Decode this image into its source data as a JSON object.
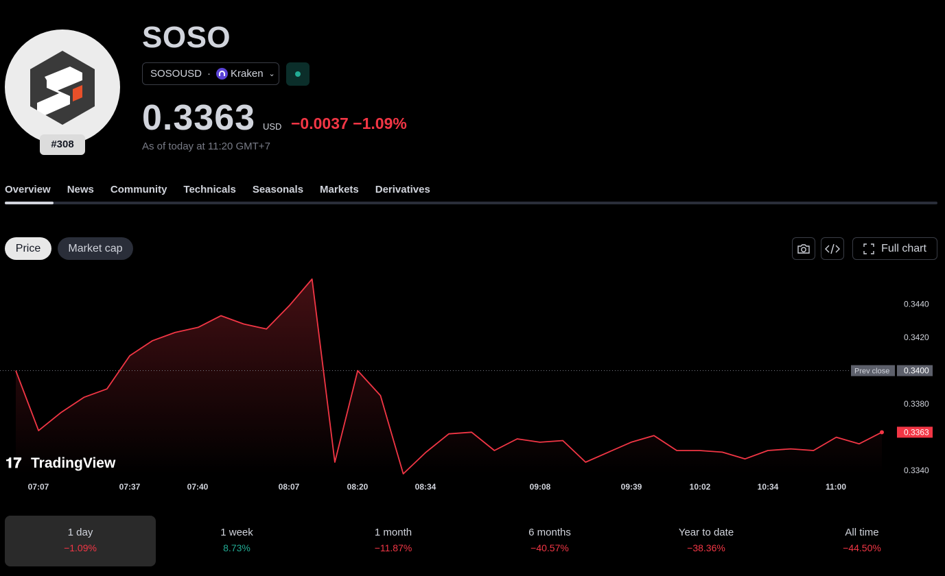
{
  "coin": {
    "name": "SOSO",
    "rank": "#308",
    "pair": "SOSOUSD",
    "separator": "·",
    "exchange": "Kraken",
    "price": "0.3363",
    "currency": "USD",
    "change": "−0.0037 −1.09%",
    "as_of": "As of today at 11:20 GMT+7"
  },
  "tabs": [
    "Overview",
    "News",
    "Community",
    "Technicals",
    "Seasonals",
    "Markets",
    "Derivatives"
  ],
  "chart_toggle": {
    "price": "Price",
    "market_cap": "Market cap"
  },
  "toolbar": {
    "full_chart": "Full chart"
  },
  "watermark": "TradingView",
  "chart_data": {
    "type": "area",
    "x_tick_labels": [
      "07:07",
      "07:37",
      "07:40",
      "08:07",
      "08:20",
      "08:34",
      "09:08",
      "09:39",
      "10:02",
      "10:34",
      "11:00"
    ],
    "y_tick_labels": [
      "0.3440",
      "0.3420",
      "0.3380",
      "0.3340"
    ],
    "ylim": [
      0.3333,
      0.3463
    ],
    "prev_close": {
      "label": "Prev close",
      "value": 0.34,
      "value_label": "0.3400"
    },
    "last": {
      "value": 0.3363,
      "label": "0.3363"
    },
    "series": [
      {
        "values": [
          0.34,
          0.3364,
          0.3375,
          0.3384,
          0.3389,
          0.3409,
          0.3418,
          0.3423,
          0.3426,
          0.3433,
          0.3428,
          0.3425,
          0.3439,
          0.3455,
          0.3345,
          0.34,
          0.3385,
          0.3338,
          0.3351,
          0.3362,
          0.3363,
          0.3352,
          0.3359,
          0.3357,
          0.3358,
          0.3345,
          0.3351,
          0.3357,
          0.3361,
          0.3352,
          0.3352,
          0.3351,
          0.3347,
          0.3352,
          0.3353,
          0.3352,
          0.336,
          0.3356,
          0.3363
        ]
      }
    ],
    "colors": {
      "line": "#f23645",
      "fill": "#f23645"
    },
    "grid": false
  },
  "periods": [
    {
      "label": "1 day",
      "value": "−1.09%",
      "sign": "neg"
    },
    {
      "label": "1 week",
      "value": "8.73%",
      "sign": "pos"
    },
    {
      "label": "1 month",
      "value": "−11.87%",
      "sign": "neg"
    },
    {
      "label": "6 months",
      "value": "−40.57%",
      "sign": "neg"
    },
    {
      "label": "Year to date",
      "value": "−38.36%",
      "sign": "neg"
    },
    {
      "label": "All time",
      "value": "−44.50%",
      "sign": "neg"
    }
  ]
}
